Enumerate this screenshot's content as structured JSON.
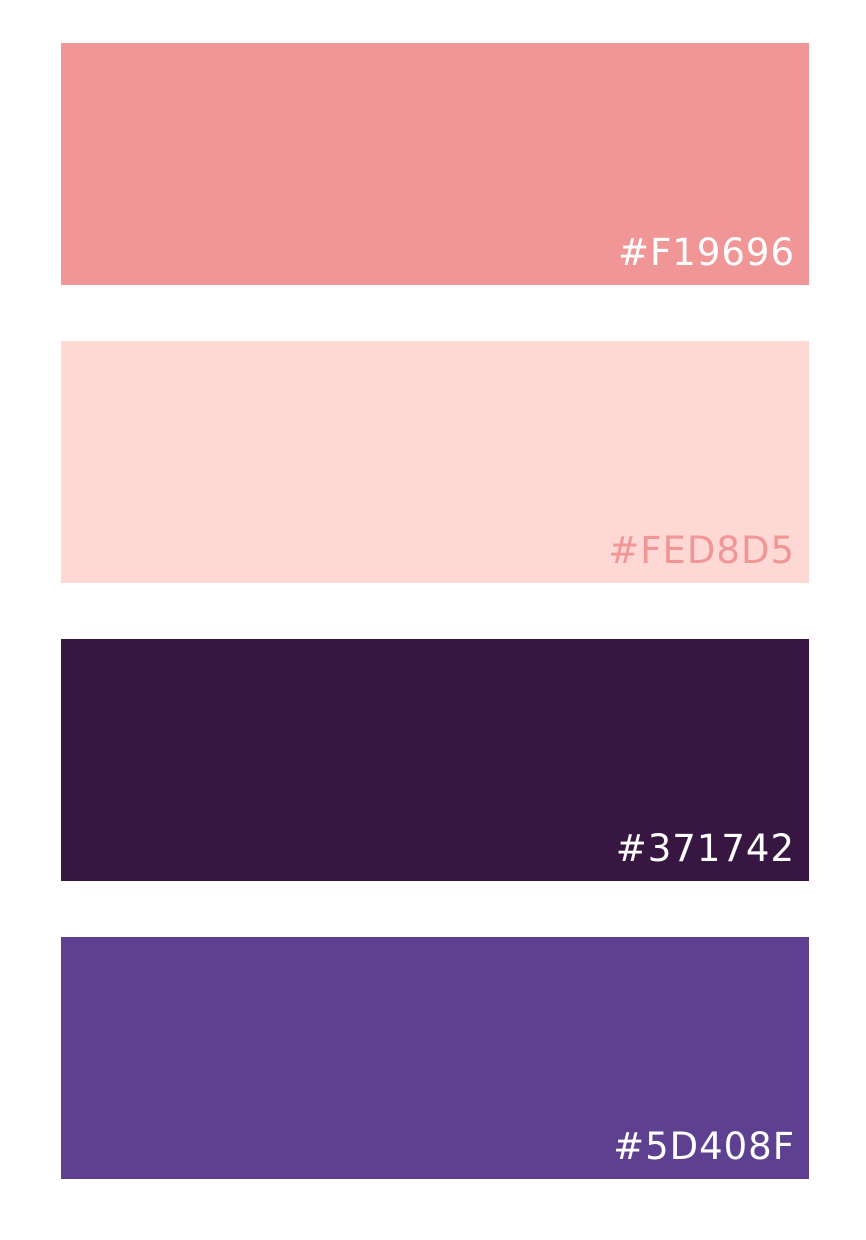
{
  "swatches": [
    {
      "color": "#F19696",
      "label": "#F19696",
      "label_color": "#FFFFFF"
    },
    {
      "color": "#FED8D5",
      "label": "#FED8D5",
      "label_color": "#F19696"
    },
    {
      "color": "#371742",
      "label": "#371742",
      "label_color": "#FFFFFF"
    },
    {
      "color": "#5D408F",
      "label": "#5D408F",
      "label_color": "#FFFFFF"
    }
  ]
}
